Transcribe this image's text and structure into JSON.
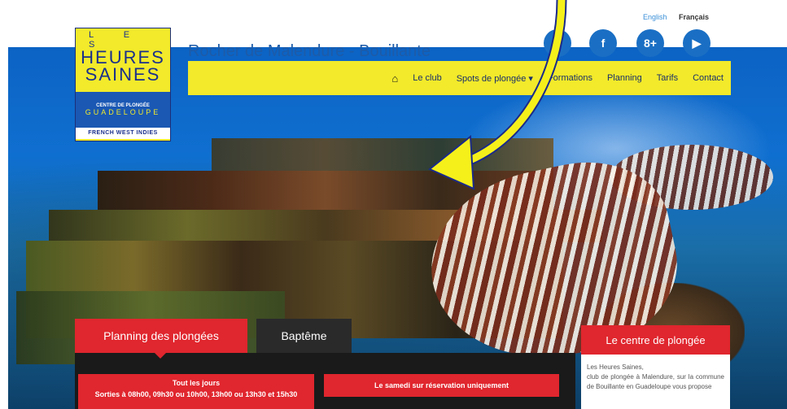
{
  "header": {
    "logo": {
      "les": "L E S",
      "heures": "HEURES",
      "saines": "SAINES",
      "centre": "CENTRE DE PLONGÉE",
      "guadeloupe": "GUADELOUPE",
      "fwi": "FRENCH WEST INDIES"
    },
    "site_title": "Rocher de Malendure - Bouillante",
    "languages": {
      "english": "English",
      "francais": "Français"
    },
    "social": {
      "phone": "✆",
      "facebook": "f",
      "googleplus": "8+",
      "youtube": "▶"
    }
  },
  "nav": {
    "home_icon": "⌂",
    "items": [
      "Le club",
      "Spots de plongée ▾",
      "Formations",
      "Planning",
      "Tarifs",
      "Contact"
    ]
  },
  "tabs": {
    "planning": "Planning des plongées",
    "bapteme": "Baptême"
  },
  "cards": {
    "left_title": "Tout les jours",
    "left_body": "Sorties à 08h00, 09h30 ou 10h00, 13h00 ou 13h30 et 15h30",
    "right_title": "Le samedi sur réservation uniquement"
  },
  "sidebar": {
    "title": "Le centre de plongée",
    "line1": "Les Heures Saines,",
    "line2": "club de plongée à Malendure, sur la commune de Bouillante en Guadeloupe vous propose"
  },
  "colors": {
    "brand_yellow": "#f2ea2a",
    "brand_blue": "#1d5ba8",
    "accent_red": "#e0262e",
    "arrow_yellow": "#f5f01a"
  }
}
